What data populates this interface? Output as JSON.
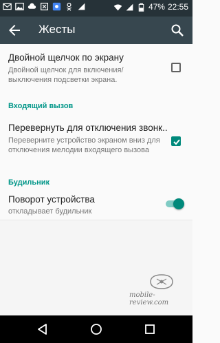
{
  "status_bar": {
    "battery": "47%",
    "time": "22:55",
    "icons": [
      "mail-icon",
      "image-icon",
      "cloud-icon",
      "close-box-icon",
      "app-icon",
      "ok-icon",
      "signal-icon",
      "cloud-icon",
      "wifi-icon",
      "cellular-icon",
      "battery-icon"
    ]
  },
  "app_bar": {
    "title": "Жесты",
    "back_icon": "arrow-back-icon",
    "search_icon": "search-icon",
    "color": "#37474f"
  },
  "settings": {
    "double_tap": {
      "title": "Двойной щелчок по экрану",
      "summary": "Двойной щелчок для включения/ выключения подсветки экрана.",
      "checked": false
    },
    "incoming_call_header": "Входящий вызов",
    "flip_to_mute": {
      "title": "Перевернуть для отключения звонк..",
      "summary": "Переверните устройство экраном вниз для отключения мелодии входящего вызова",
      "checked": true
    },
    "alarm_header": "Будильник",
    "rotate_device": {
      "title": "Поворот устройства",
      "summary": "откладывает будильник",
      "enabled": true
    }
  },
  "watermark": {
    "text": "mobile-review.com"
  },
  "nav_bar": {
    "icons": [
      "back-triangle-icon",
      "home-circle-icon",
      "recents-square-icon"
    ]
  },
  "colors": {
    "accent": "#009688",
    "status_bar": "#263238",
    "app_bar": "#37474f"
  }
}
